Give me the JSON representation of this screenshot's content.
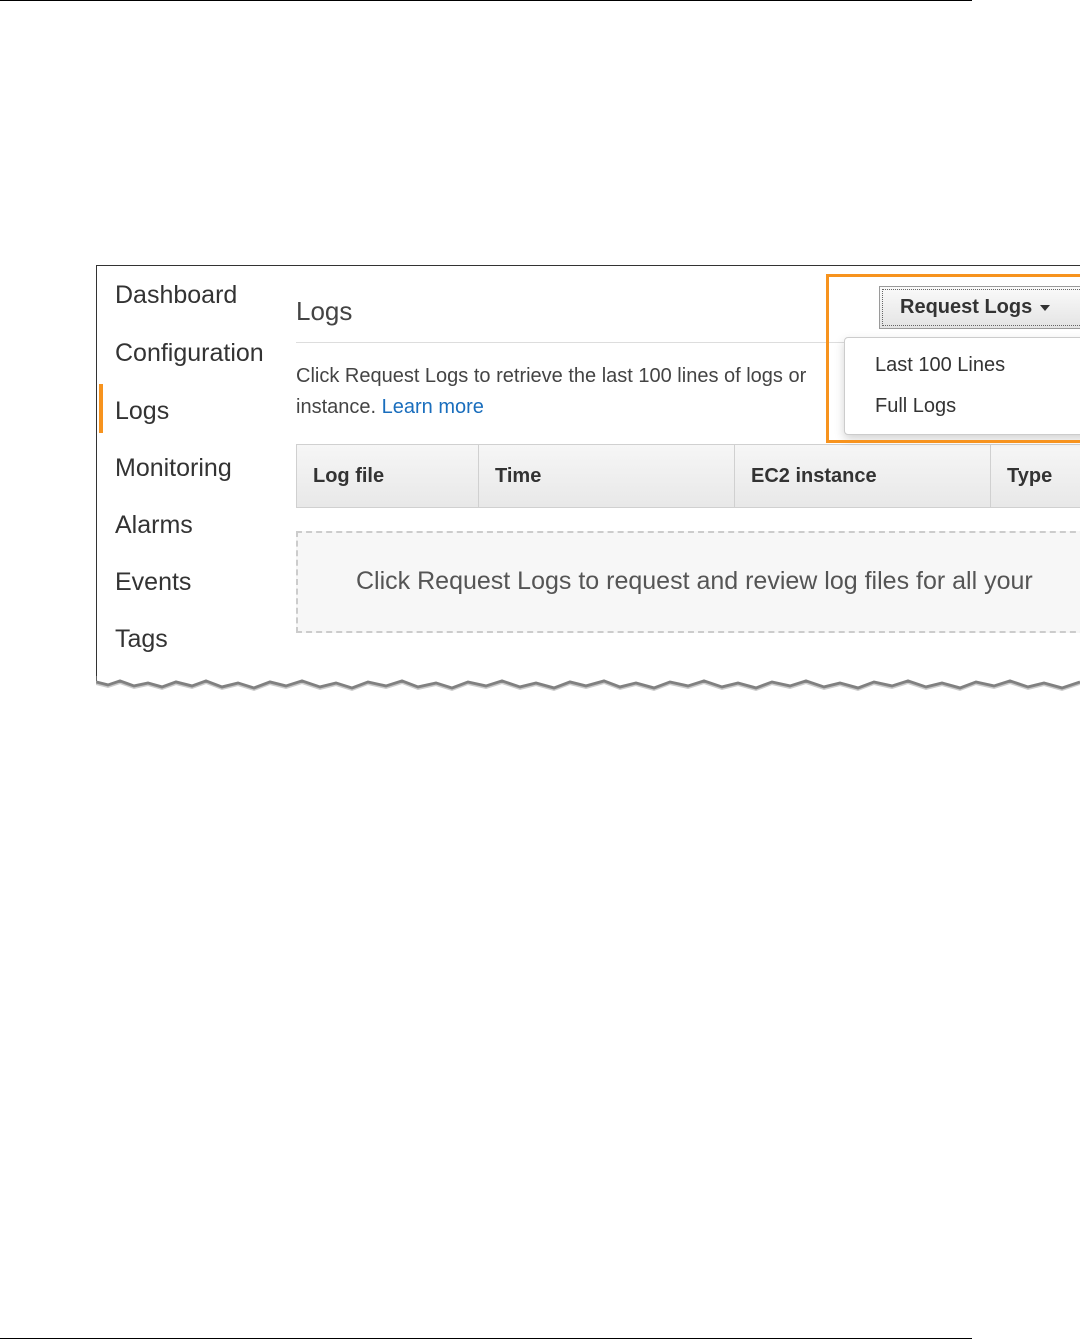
{
  "sidebar": {
    "items": [
      {
        "label": "Dashboard"
      },
      {
        "label": "Configuration"
      },
      {
        "label": "Logs"
      },
      {
        "label": "Monitoring"
      },
      {
        "label": "Alarms"
      },
      {
        "label": "Events"
      },
      {
        "label": "Tags"
      }
    ],
    "active": "Logs"
  },
  "main": {
    "title": "Logs",
    "description": "Click Request Logs to retrieve the last 100 lines of logs or",
    "description_line2": "instance.",
    "learn_more": "Learn more",
    "request_button": "Request Logs",
    "dropdown": {
      "items": [
        {
          "label": "Last 100 Lines"
        },
        {
          "label": "Full Logs"
        }
      ]
    },
    "table": {
      "columns": [
        "Log file",
        "Time",
        "EC2 instance",
        "Type"
      ]
    },
    "empty_message": "Click Request Logs to request and review log files for all your"
  },
  "colors": {
    "accent": "#f7931e",
    "link": "#1a6ebd"
  }
}
